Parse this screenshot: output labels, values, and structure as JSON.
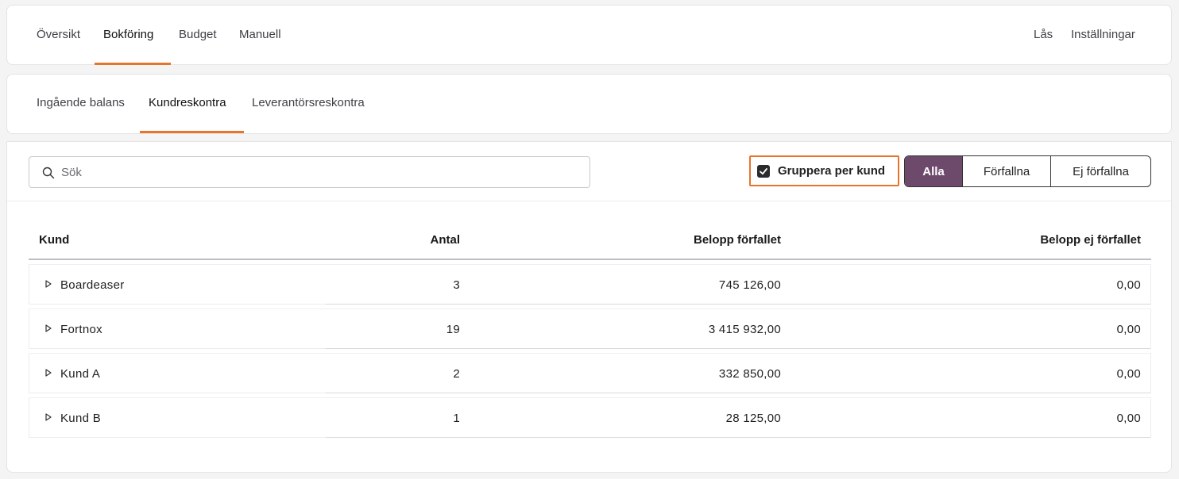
{
  "top_nav": {
    "tabs": [
      {
        "label": "Översikt"
      },
      {
        "label": "Bokföring"
      },
      {
        "label": "Budget"
      },
      {
        "label": "Manuell"
      }
    ],
    "active": "Bokföring",
    "right": [
      {
        "label": "Lås"
      },
      {
        "label": "Inställningar"
      }
    ]
  },
  "sub_nav": {
    "tabs": [
      {
        "label": "Ingående balans"
      },
      {
        "label": "Kundreskontra"
      },
      {
        "label": "Leverantörsreskontra"
      }
    ],
    "active": "Kundreskontra"
  },
  "toolbar": {
    "search_placeholder": "Sök",
    "search_value": "",
    "group_by_customer": {
      "label": "Gruppera per kund",
      "checked": true
    },
    "filter": {
      "options": [
        {
          "label": "Alla"
        },
        {
          "label": "Förfallna"
        },
        {
          "label": "Ej förfallna"
        }
      ],
      "selected": "Alla"
    }
  },
  "table": {
    "headers": {
      "kund": "Kund",
      "antal": "Antal",
      "belopp_forfallet": "Belopp förfallet",
      "belopp_ej_forfallet": "Belopp ej förfallet"
    },
    "rows": [
      {
        "kund": "Boardeaser",
        "antal": "3",
        "belopp_forfallet": "745 126,00",
        "belopp_ej_forfallet": "0,00"
      },
      {
        "kund": "Fortnox",
        "antal": "19",
        "belopp_forfallet": "3 415 932,00",
        "belopp_ej_forfallet": "0,00"
      },
      {
        "kund": "Kund A",
        "antal": "2",
        "belopp_forfallet": "332 850,00",
        "belopp_ej_forfallet": "0,00"
      },
      {
        "kund": "Kund B",
        "antal": "1",
        "belopp_forfallet": "28 125,00",
        "belopp_ej_forfallet": "0,00"
      }
    ]
  },
  "colors": {
    "accent": "#e8742c",
    "segment_active": "#6d4a6b"
  }
}
